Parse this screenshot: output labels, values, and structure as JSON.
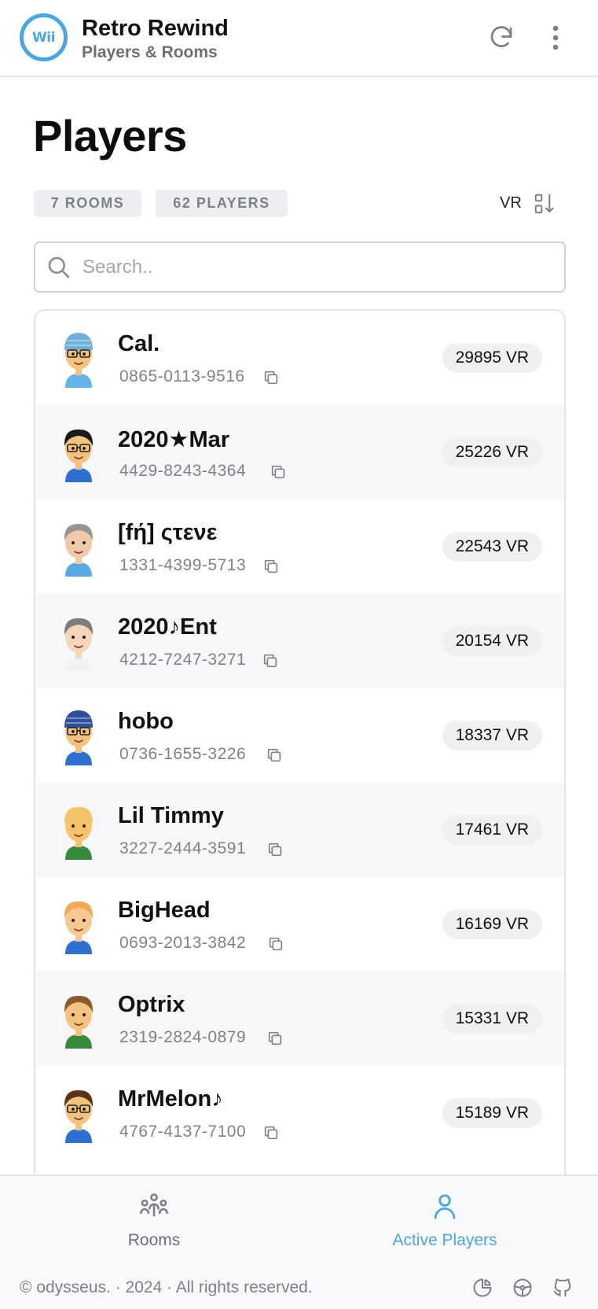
{
  "header": {
    "logo_text": "Wii",
    "title": "Retro Rewind",
    "subtitle": "Players & Rooms",
    "refresh_icon": "refresh-icon",
    "menu_icon": "more-vertical-icon"
  },
  "page": {
    "title": "Players",
    "rooms_chip": "7 ROOMS",
    "players_chip": "62 PLAYERS",
    "sort_label": "VR",
    "sort_icon": "sort-descending-icon"
  },
  "search": {
    "placeholder": "Search..",
    "value": ""
  },
  "players": [
    {
      "name": "Cal.",
      "friend_code": "0865-0113-9516",
      "vr": "29895 VR",
      "mii": {
        "skin": "#f2c27e",
        "hair": "#3a8fd0",
        "shirt": "#62b4e8",
        "hat": "#6fb0d8",
        "glasses": true
      }
    },
    {
      "name": "2020★Mar",
      "friend_code": "4429-8243-4364",
      "vr": "25226 VR",
      "mii": {
        "skin": "#f2c27e",
        "hair": "#1a1a1a",
        "shirt": "#2f6fd0",
        "hat": "",
        "glasses": true
      }
    },
    {
      "name": "[fή] ςτενε",
      "friend_code": "1331-4399-5713",
      "vr": "22543 VR",
      "mii": {
        "skin": "#f0c9a8",
        "hair": "#9a9490",
        "shirt": "#5aa9e0",
        "hat": "",
        "glasses": false
      }
    },
    {
      "name": "2020♪Ent",
      "friend_code": "4212-7247-3271",
      "vr": "20154 VR",
      "mii": {
        "skin": "#f5d6b8",
        "hair": "#7d7b7b",
        "shirt": "#f2f2f2",
        "hat": "",
        "glasses": false
      }
    },
    {
      "name": "hobo",
      "friend_code": "0736-1655-3226",
      "vr": "18337 VR",
      "mii": {
        "skin": "#f2c27e",
        "hair": "#2a4f9c",
        "shirt": "#2f6fd0",
        "hat": "#2a4f9c",
        "glasses": true
      }
    },
    {
      "name": "Lil Timmy",
      "friend_code": "3227-2444-3591",
      "vr": "17461 VR",
      "mii": {
        "skin": "#f5c46a",
        "hair": "#f5c46a",
        "shirt": "#3a8a3e",
        "hat": "",
        "glasses": false
      }
    },
    {
      "name": "BigHead",
      "friend_code": "0693-2013-3842",
      "vr": "16169 VR",
      "mii": {
        "skin": "#f7c990",
        "hair": "#f0a955",
        "shirt": "#2f6fd0",
        "hat": "",
        "glasses": false
      }
    },
    {
      "name": "Optrix",
      "friend_code": "2319-2824-0879",
      "vr": "15331 VR",
      "mii": {
        "skin": "#f2c27e",
        "hair": "#8a5a2b",
        "shirt": "#3a8a3e",
        "hat": "",
        "glasses": false
      }
    },
    {
      "name": "MrMelon♪",
      "friend_code": "4767-4137-7100",
      "vr": "15189 VR",
      "mii": {
        "skin": "#f2c27e",
        "hair": "#5a3418",
        "shirt": "#2f6fd0",
        "hat": "",
        "glasses": true
      }
    }
  ],
  "nav": {
    "rooms_label": "Rooms",
    "active_players_label": "Active Players",
    "active_color": "#4ba6e3"
  },
  "footer": {
    "text": "© odysseus. · 2024 · All rights reserved.",
    "icons": [
      "pie-chart-icon",
      "steering-wheel-icon",
      "github-icon"
    ]
  }
}
